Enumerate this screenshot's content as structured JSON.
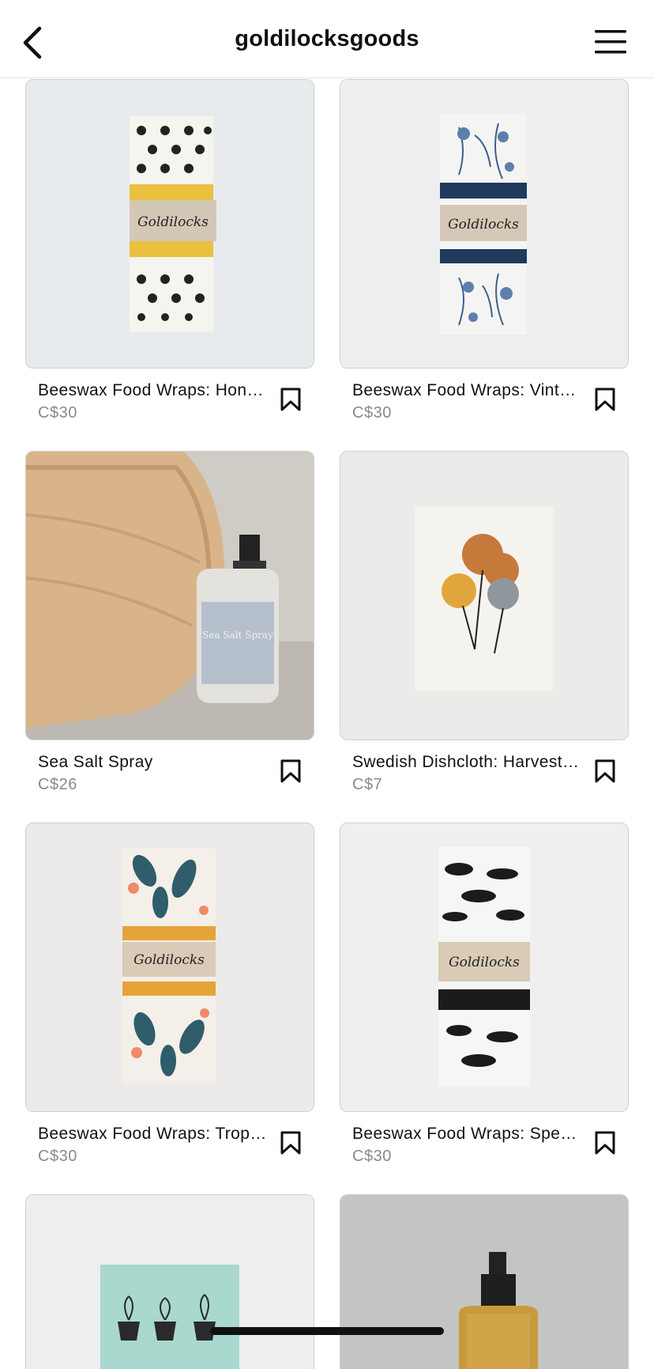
{
  "header": {
    "title": "goldilocksgoods",
    "back_icon": "chevron-left-icon",
    "menu_icon": "hamburger-menu-icon"
  },
  "products": [
    {
      "name": "Beeswax Food Wraps: Honeybee",
      "price": "C$30"
    },
    {
      "name": "Beeswax Food Wraps: Vintage Botanical",
      "price": "C$30"
    },
    {
      "name": "Sea Salt Spray",
      "price": "C$26"
    },
    {
      "name": "Swedish Dishcloth: Harvest Bloom",
      "price": "C$7"
    },
    {
      "name": "Beeswax Food Wraps: Tropical",
      "price": "C$30"
    },
    {
      "name": "Beeswax Food Wraps: Species",
      "price": "C$30"
    }
  ],
  "product_images": {
    "brand_band_text": "Goldilocks",
    "sea_salt_label": "Sea Salt Spray"
  },
  "colors": {
    "text": "#111111",
    "price": "#8a8a8a",
    "border": "#cfcfcf"
  }
}
